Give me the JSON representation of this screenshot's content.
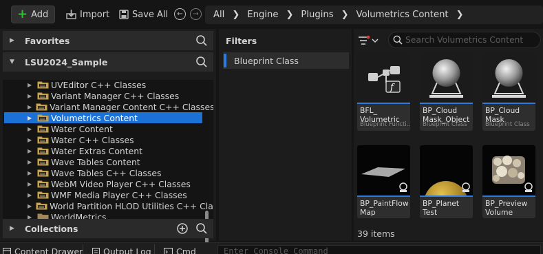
{
  "toolbar": {
    "add_label": "Add",
    "import_label": "Import",
    "save_all_label": "Save All"
  },
  "breadcrumb": [
    "All",
    "Engine",
    "Plugins",
    "Volumetrics Content"
  ],
  "left_panel": {
    "favorites_label": "Favorites",
    "project_label": "LSU2024_Sample",
    "collections_label": "Collections",
    "tree_items": [
      {
        "label": "UVEditor C++ Classes",
        "selected": false
      },
      {
        "label": "Variant Manager C++ Classes",
        "selected": false
      },
      {
        "label": "Variant Manager Content C++ Classes",
        "selected": false
      },
      {
        "label": "Volumetrics Content",
        "selected": true
      },
      {
        "label": "Water Content",
        "selected": false
      },
      {
        "label": "Water C++ Classes",
        "selected": false
      },
      {
        "label": "Water Extras Content",
        "selected": false
      },
      {
        "label": "Wave Tables Content",
        "selected": false
      },
      {
        "label": "Wave Tables C++ Classes",
        "selected": false
      },
      {
        "label": "WebM Video Player C++ Classes",
        "selected": false
      },
      {
        "label": "WMF Media Player C++ Classes",
        "selected": false
      },
      {
        "label": "World Partition HLOD Utilities C++ Classes",
        "selected": false
      },
      {
        "label": "WorldMetrics",
        "selected": false
      }
    ]
  },
  "filters": {
    "title": "Filters",
    "items": [
      "Blueprint Class"
    ],
    "accent": "#2d7be0"
  },
  "content": {
    "search_placeholder": "Search Volumetrics Content",
    "items_count": "39 items",
    "assets": [
      {
        "name": "BFL_\nVolumetric",
        "class": "Blueprint Functi...",
        "thumb": "function-library-icon"
      },
      {
        "name": "BP_Cloud\nMask_Object",
        "class": "Blueprint Class",
        "thumb": "sphere-pedestal-icon"
      },
      {
        "name": "BP_Cloud\nMask",
        "class": "Blueprint Class",
        "thumb": "sphere-pedestal-icon"
      },
      {
        "name": "BP_PaintFlow\nMap",
        "class": "",
        "thumb": "plane-thumbnail"
      },
      {
        "name": "BP_Planet\nTest",
        "class": "",
        "thumb": "planet-thumbnail"
      },
      {
        "name": "BP_Preview\nVolume",
        "class": "",
        "thumb": "cloud-volume-thumbnail"
      }
    ]
  },
  "bottom_bar": {
    "content_drawer_label": "Content Drawer",
    "output_log_label": "Output Log",
    "cmd_label": "Cmd",
    "console_placeholder": "Enter Console Command"
  },
  "colors": {
    "selection": "#1b71d6",
    "add_green": "#2ec12e",
    "folder": "#c7a24a"
  }
}
